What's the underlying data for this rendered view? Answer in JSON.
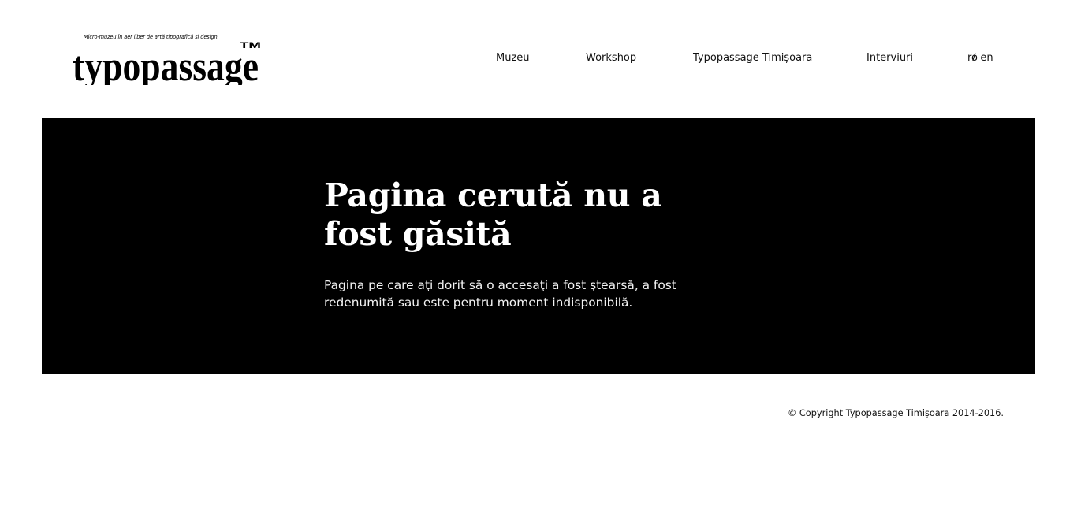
{
  "header": {
    "logo": {
      "tagline": "Micro-muzeu în aer liber de artă tipografică și design.",
      "wordmark": "typopassage",
      "superscript": "TM"
    },
    "nav": [
      {
        "label": "Muzeu"
      },
      {
        "label": "Workshop"
      },
      {
        "label": "Typopassage Timișoara"
      },
      {
        "label": "Interviuri"
      }
    ],
    "lang": {
      "ro": "ro",
      "separator": "/",
      "en": "en"
    }
  },
  "hero": {
    "title": "Pagina cerută nu a fost găsită",
    "text": "Pagina pe care aţi dorit să o accesaţi a fost ştearsă, a fost redenumită sau este pentru moment indisponibilă."
  },
  "footer": {
    "copyright": "© Copyright Typopassage Timișoara 2014-2016."
  },
  "colors": {
    "background": "#ffffff",
    "hero_background": "#000000",
    "hero_text": "#ffffff",
    "text": "#111111"
  }
}
